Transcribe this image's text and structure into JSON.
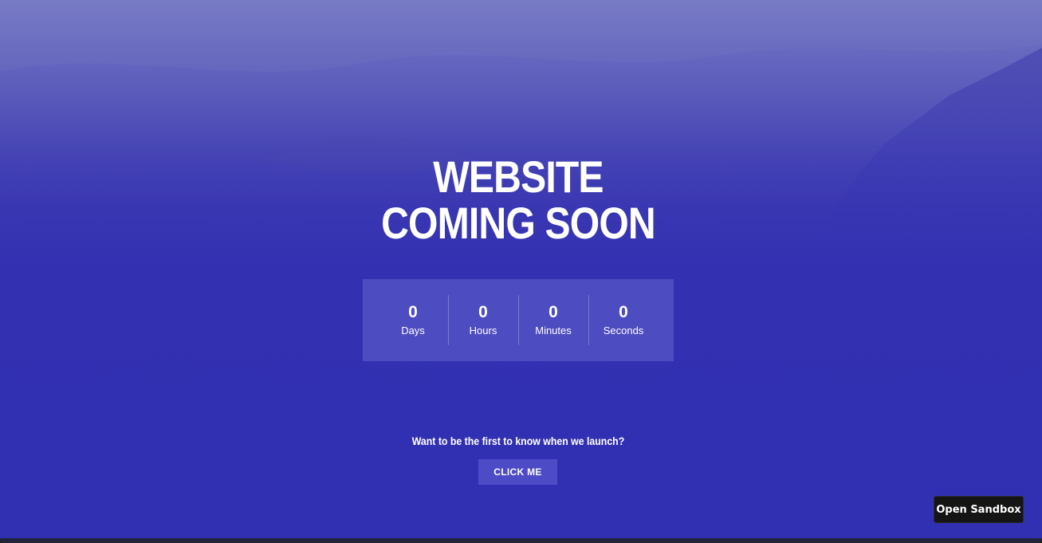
{
  "hero": {
    "title_line1": "WEBSITE",
    "title_line2": "COMING SOON"
  },
  "countdown": [
    {
      "value": "0",
      "label": "Days"
    },
    {
      "value": "0",
      "label": "Hours"
    },
    {
      "value": "0",
      "label": "Minutes"
    },
    {
      "value": "0",
      "label": "Seconds"
    }
  ],
  "cta": {
    "text": "Want to be the first to know when we launch?",
    "button_label": "CLICK ME"
  },
  "sandbox": {
    "button_label": "Open Sandbox"
  },
  "colors": {
    "background_primary": "#3230b2",
    "button": "#4d4bc6",
    "sandbox_button": "#151515"
  }
}
